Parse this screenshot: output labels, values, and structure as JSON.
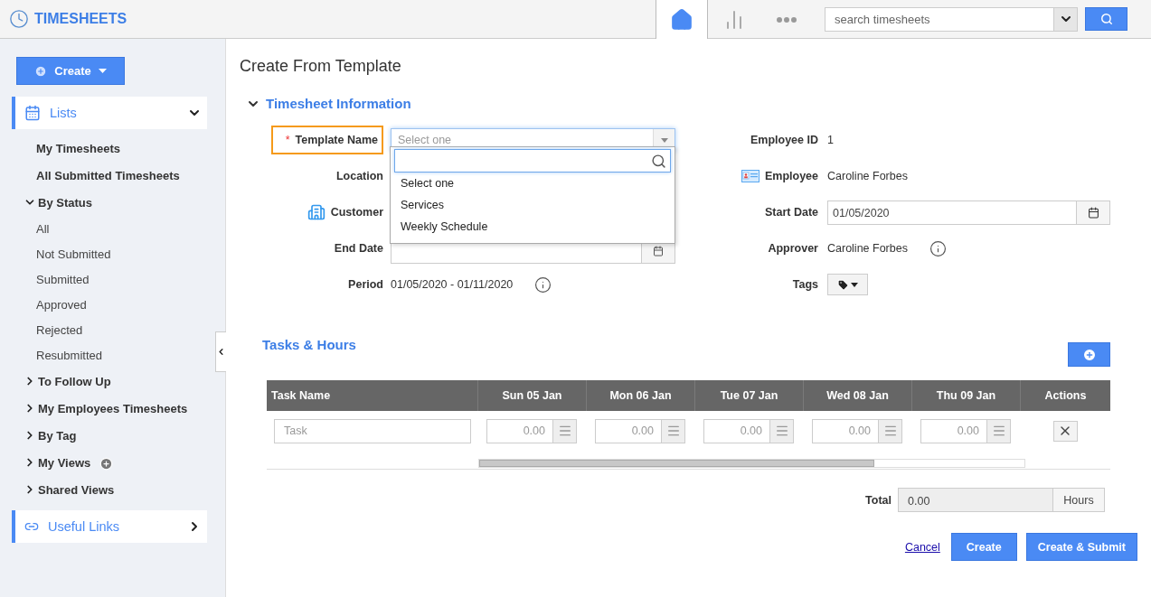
{
  "app": {
    "title": "TIMESHEETS"
  },
  "nav": [
    {
      "kind": "home",
      "selected": true
    },
    {
      "kind": "chart",
      "selected": false
    },
    {
      "kind": "more",
      "selected": false
    }
  ],
  "search": {
    "placeholder": "search timesheets"
  },
  "sidebar": {
    "create_button": "Create",
    "lists_panel": {
      "label": "Lists",
      "expanded": true
    },
    "items": [
      {
        "kind": "link",
        "label": "My Timesheets"
      },
      {
        "kind": "link",
        "label": "All Submitted Timesheets"
      },
      {
        "kind": "group",
        "label": "By Status",
        "expanded": true,
        "children": [
          {
            "label": "All"
          },
          {
            "label": "Not Submitted"
          },
          {
            "label": "Submitted"
          },
          {
            "label": "Approved"
          },
          {
            "label": "Rejected"
          },
          {
            "label": "Resubmitted"
          }
        ]
      },
      {
        "kind": "group",
        "label": "To Follow Up",
        "expanded": false
      },
      {
        "kind": "group",
        "label": "My Employees Timesheets",
        "expanded": false
      },
      {
        "kind": "group",
        "label": "By Tag",
        "expanded": false
      },
      {
        "kind": "group_add",
        "label": "My Views",
        "expanded": false
      },
      {
        "kind": "group",
        "label": "Shared Views",
        "expanded": false
      }
    ],
    "links_panel": {
      "label": "Useful Links",
      "expanded": false
    }
  },
  "page_title": "Create From Template",
  "info_section": {
    "title": "Timesheet Information",
    "expanded": true,
    "left_fields": [
      {
        "kind": "select",
        "label": "Template Name",
        "required_mark": "*",
        "placeholder": "Select one"
      },
      {
        "kind": "covered",
        "label": "Location"
      },
      {
        "kind": "covered_building",
        "label": "Customer"
      },
      {
        "kind": "date_covered",
        "label": "End Date"
      },
      {
        "kind": "text_info",
        "label": "Period",
        "value": "01/05/2020 - 01/11/2020"
      }
    ],
    "right_fields": [
      {
        "kind": "text",
        "label": "Employee ID",
        "value": "1"
      },
      {
        "kind": "text_card",
        "label": "Employee",
        "value": "Caroline Forbes"
      },
      {
        "kind": "date",
        "label": "Start Date",
        "value": "01/05/2020"
      },
      {
        "kind": "text_info",
        "label": "Approver",
        "value": "Caroline Forbes"
      },
      {
        "kind": "tags",
        "label": "Tags"
      }
    ],
    "dropdown": {
      "open": true,
      "options": [
        {
          "label": "Select one"
        },
        {
          "label": "Services"
        },
        {
          "label": "Weekly Schedule"
        }
      ]
    }
  },
  "tasks": {
    "title": "Tasks & Hours",
    "columns": [
      "Task Name",
      "Sun 05 Jan",
      "Mon 06 Jan",
      "Tue 07 Jan",
      "Wed 08 Jan",
      "Thu 09 Jan",
      "Actions"
    ],
    "rows": [
      {
        "task_placeholder": "Task",
        "hours_placeholders": [
          "0.00",
          "0.00",
          "0.00",
          "0.00",
          "0.00"
        ]
      }
    ],
    "total_label": "Total",
    "total_value": "0.00",
    "total_unit": "Hours"
  },
  "actions": {
    "cancel": "Cancel",
    "create": "Create",
    "create_submit": "Create & Submit"
  }
}
